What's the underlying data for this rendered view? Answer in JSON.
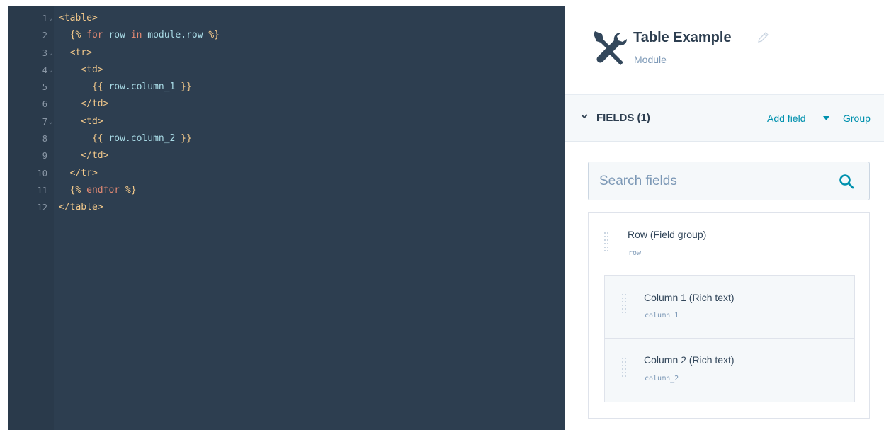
{
  "editor": {
    "lines": [
      {
        "num": "1",
        "fold": true,
        "tokens": [
          {
            "t": "tag",
            "v": "<table>"
          }
        ]
      },
      {
        "num": "2",
        "fold": false,
        "tokens": [
          {
            "t": "indent",
            "v": "  "
          },
          {
            "t": "delim",
            "v": "{%"
          },
          {
            "t": "plain",
            "v": " "
          },
          {
            "t": "kw",
            "v": "for"
          },
          {
            "t": "plain",
            "v": " "
          },
          {
            "t": "var",
            "v": "row"
          },
          {
            "t": "plain",
            "v": " "
          },
          {
            "t": "kw",
            "v": "in"
          },
          {
            "t": "plain",
            "v": " "
          },
          {
            "t": "var",
            "v": "module.row"
          },
          {
            "t": "plain",
            "v": " "
          },
          {
            "t": "delim",
            "v": "%}"
          }
        ]
      },
      {
        "num": "3",
        "fold": true,
        "tokens": [
          {
            "t": "indent",
            "v": "  "
          },
          {
            "t": "tag",
            "v": "<tr>"
          }
        ]
      },
      {
        "num": "4",
        "fold": true,
        "tokens": [
          {
            "t": "indent",
            "v": "    "
          },
          {
            "t": "tag",
            "v": "<td>"
          }
        ]
      },
      {
        "num": "5",
        "fold": false,
        "tokens": [
          {
            "t": "indent",
            "v": "      "
          },
          {
            "t": "delim",
            "v": "{{"
          },
          {
            "t": "plain",
            "v": " "
          },
          {
            "t": "var",
            "v": "row.column_1"
          },
          {
            "t": "plain",
            "v": " "
          },
          {
            "t": "delim",
            "v": "}}"
          }
        ]
      },
      {
        "num": "6",
        "fold": false,
        "tokens": [
          {
            "t": "indent",
            "v": "    "
          },
          {
            "t": "tag",
            "v": "</td>"
          }
        ]
      },
      {
        "num": "7",
        "fold": true,
        "tokens": [
          {
            "t": "indent",
            "v": "    "
          },
          {
            "t": "tag",
            "v": "<td>"
          }
        ]
      },
      {
        "num": "8",
        "fold": false,
        "tokens": [
          {
            "t": "indent",
            "v": "      "
          },
          {
            "t": "delim",
            "v": "{{"
          },
          {
            "t": "plain",
            "v": " "
          },
          {
            "t": "var",
            "v": "row.column_2"
          },
          {
            "t": "plain",
            "v": " "
          },
          {
            "t": "delim",
            "v": "}}"
          }
        ]
      },
      {
        "num": "9",
        "fold": false,
        "tokens": [
          {
            "t": "indent",
            "v": "    "
          },
          {
            "t": "tag",
            "v": "</td>"
          }
        ]
      },
      {
        "num": "10",
        "fold": false,
        "tokens": [
          {
            "t": "indent",
            "v": "  "
          },
          {
            "t": "tag",
            "v": "</tr>"
          }
        ]
      },
      {
        "num": "11",
        "fold": false,
        "tokens": [
          {
            "t": "indent",
            "v": "  "
          },
          {
            "t": "delim",
            "v": "{%"
          },
          {
            "t": "plain",
            "v": " "
          },
          {
            "t": "kw",
            "v": "endfor"
          },
          {
            "t": "plain",
            "v": " "
          },
          {
            "t": "delim",
            "v": "%}"
          }
        ]
      },
      {
        "num": "12",
        "fold": false,
        "tokens": [
          {
            "t": "tag",
            "v": "</table>"
          }
        ]
      }
    ]
  },
  "module": {
    "title": "Table Example",
    "subtitle": "Module",
    "icon": "wrench-screwdriver-icon"
  },
  "fields_bar": {
    "title": "FIELDS (1)",
    "add_field": "Add field",
    "group": "Group"
  },
  "search": {
    "placeholder": "Search fields",
    "value": ""
  },
  "fields": {
    "group": {
      "name": "Row (Field group)",
      "key": "row"
    },
    "children": [
      {
        "name": "Column 1 (Rich text)",
        "key": "column_1"
      },
      {
        "name": "Column 2 (Rich text)",
        "key": "column_2"
      }
    ]
  },
  "colors": {
    "editor_bg": "#2d3e50",
    "accent_link": "#0091ae",
    "heading": "#2d3e50"
  }
}
